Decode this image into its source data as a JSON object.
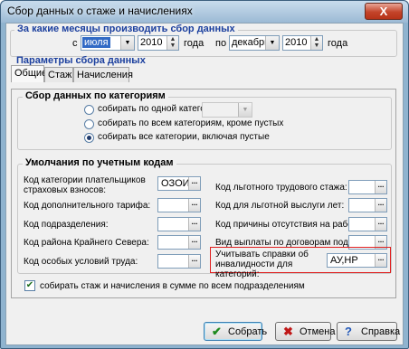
{
  "window": {
    "title": "Сбор данных о стаже и начислениях",
    "close_glyph": "X"
  },
  "months": {
    "caption": "За какие месяцы производить сбор данных",
    "from_label": "с",
    "from_month": "июля",
    "from_year": "2010",
    "year_word_1": "года",
    "to_label": "по",
    "to_month": "декабрь",
    "to_year": "2010",
    "year_word_2": "года"
  },
  "params": {
    "caption": "Параметры сбора данных",
    "tabs": [
      {
        "label": "Общие",
        "active": true
      },
      {
        "label": "Стаж",
        "active": false
      },
      {
        "label": "Начисления",
        "active": false
      }
    ]
  },
  "category": {
    "caption": "Сбор данных по категориям",
    "options": [
      {
        "label": "собирать по одной категории",
        "selected": false
      },
      {
        "label": "собирать по всем категориям, кроме пустых",
        "selected": false
      },
      {
        "label": "собирать все категории, включая пустые",
        "selected": true
      }
    ]
  },
  "defaults": {
    "caption": "Умолчания по учетным кодам",
    "left": [
      {
        "label": "Код категории плательщиков страховых взносов:",
        "value": "ОЗОИ"
      },
      {
        "label": "Код дополнительного тарифа:",
        "value": ""
      },
      {
        "label": "Код подразделения:",
        "value": ""
      },
      {
        "label": "Код района Крайнего Севера:",
        "value": ""
      },
      {
        "label": "Код особых условий труда:",
        "value": ""
      }
    ],
    "right": [
      {
        "label": "Код льготного трудового стажа:",
        "value": ""
      },
      {
        "label": "Код для льготной выслуги лет:",
        "value": ""
      },
      {
        "label": "Код причины отсутствия на работе:",
        "value": ""
      },
      {
        "label": "Вид выплаты по договорам подряда:",
        "value": ""
      }
    ],
    "disability_label": "Учитывать справки об инвалидности для категорий:",
    "disability_value": "АУ,НР"
  },
  "sum_checkbox": {
    "label": "собирать стаж и начисления в сумме по всем подразделениям",
    "checked": true
  },
  "buttons": {
    "ok": "Собрать",
    "cancel": "Отмена",
    "help": "Справка"
  },
  "icons": {
    "ok": "check-icon",
    "cancel": "cross-icon",
    "help": "question-icon"
  },
  "colors": {
    "caption_blue": "#1b3f9e",
    "highlight_red": "#e02020",
    "selection": "#316ac5"
  }
}
